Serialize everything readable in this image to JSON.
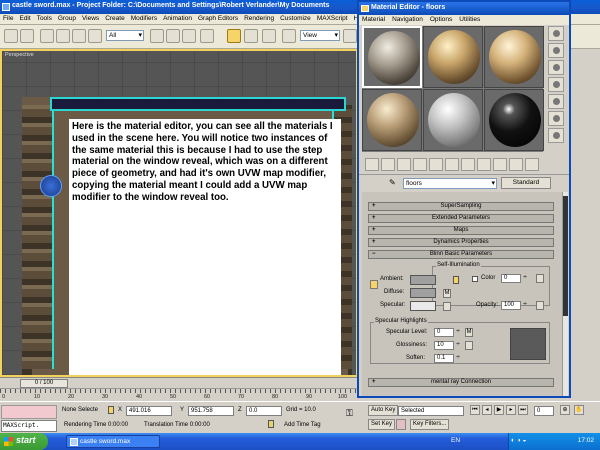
{
  "app": {
    "title": "castle sword.max    - Project Folder: C:\\Documents and Settings\\Robert Verlander\\My Documents",
    "menu": [
      "File",
      "Edit",
      "Tools",
      "Group",
      "Views",
      "Create",
      "Modifiers",
      "Animation",
      "Graph Editors",
      "Rendering",
      "Customize",
      "MAXScript",
      "Help"
    ],
    "toolbar": {
      "selection_filter": "All",
      "ref_coord": "View"
    }
  },
  "viewport": {
    "label": "Perspective",
    "note": "Here is the material editor, you can see all the materials I used in the scene here.  You will notice two instances of the same material this is because I had to use the step material on the window reveal, which was on a different piece of geometry, and had it's own UVW map modifier, copying the material meant I could add a UVW map modifier to the window reveal too."
  },
  "timeline": {
    "slider": "0 / 100",
    "ticks": [
      "0",
      "10",
      "20",
      "30",
      "40",
      "50",
      "60",
      "70",
      "80",
      "90",
      "100"
    ]
  },
  "status": {
    "selection": "None Selecte",
    "x_label": "X",
    "x_value": "491.016",
    "y_label": "Y",
    "y_value": "951.758",
    "z_label": "Z",
    "z_value": "0.0",
    "grid": "Grid = 10.0",
    "auto_key": "Auto Key",
    "set_key": "Set Key",
    "key_mode": "Selected",
    "key_filters": "Key Filters...",
    "rendering_time": "Rendering Time  0:00:00",
    "translation_time": "Translation Time  0:00:00",
    "add_time_tag": "Add Time Tag",
    "maxscript": "MAXScript.",
    "frame": "0"
  },
  "taskbar": {
    "start": "start",
    "task": "castle sword.max",
    "lang": "EN",
    "clock": "17:02"
  },
  "material_editor": {
    "title": "Material Editor - floors",
    "menu": [
      "Material",
      "Navigation",
      "Options",
      "Utilities"
    ],
    "material_name": "floors",
    "material_type": "Standard",
    "rollouts": [
      "SuperSampling",
      "Extended Parameters",
      "Maps",
      "Dynamics Properties",
      "Blinn Basic Parameters"
    ],
    "blinn": {
      "self_illumination": "Self-Illumination",
      "color_label": "Color",
      "color_value": "0",
      "ambient": "Ambient:",
      "diffuse": "Diffuse:",
      "specular": "Specular:",
      "m_label": "M",
      "opacity_label": "Opacity:",
      "opacity_value": "100",
      "specular_highlights": "Specular Highlights",
      "specular_level_label": "Specular Level:",
      "specular_level_value": "0",
      "glossiness_label": "Glossiness:",
      "glossiness_value": "10",
      "soften_label": "Soften:",
      "soften_value": "0.1"
    },
    "bottom_rollout": "mental ray Connection"
  }
}
